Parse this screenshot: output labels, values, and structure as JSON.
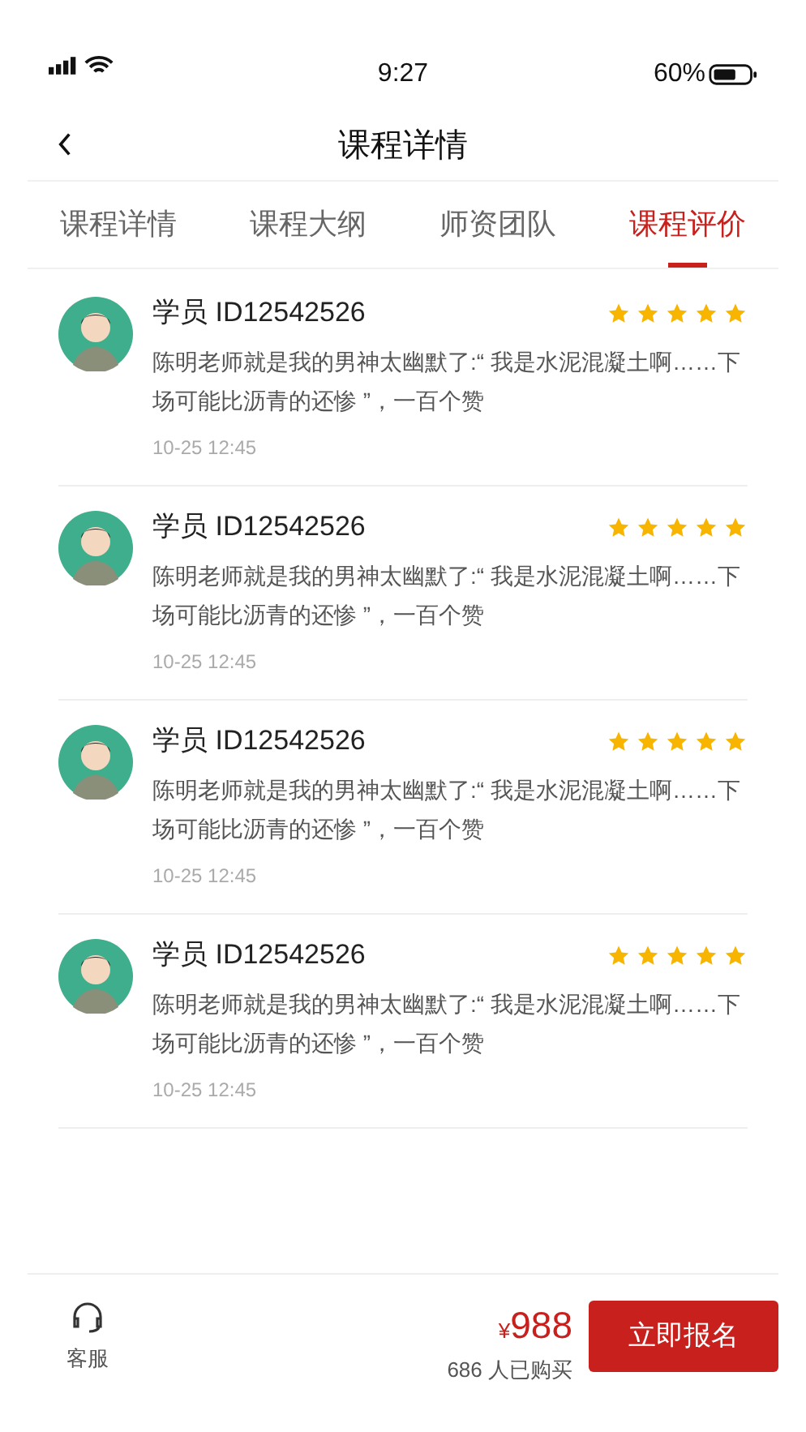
{
  "status_bar": {
    "time": "9:27",
    "battery": "60%"
  },
  "nav": {
    "title": "课程详情"
  },
  "tabs": [
    {
      "label": "课程详情",
      "selected": false
    },
    {
      "label": "课程大纲",
      "selected": false
    },
    {
      "label": "师资团队",
      "selected": false
    },
    {
      "label": "课程评价",
      "selected": true
    }
  ],
  "reviews": [
    {
      "user": "学员 ID12542526",
      "stars": 5,
      "comment": "陈明老师就是我的男神太幽默了:“ 我是水泥混凝土啊……下场可能比沥青的还惨 ”，一百个赞",
      "time": "10-25  12:45"
    },
    {
      "user": "学员 ID12542526",
      "stars": 5,
      "comment": "陈明老师就是我的男神太幽默了:“ 我是水泥混凝土啊……下场可能比沥青的还惨 ”，一百个赞",
      "time": "10-25  12:45"
    },
    {
      "user": "学员 ID12542526",
      "stars": 5,
      "comment": "陈明老师就是我的男神太幽默了:“ 我是水泥混凝土啊……下场可能比沥青的还惨 ”，一百个赞",
      "time": "10-25  12:45"
    },
    {
      "user": "学员 ID12542526",
      "stars": 5,
      "comment": "陈明老师就是我的男神太幽默了:“ 我是水泥混凝土啊……下场可能比沥青的还惨 ”，一百个赞",
      "time": "10-25  12:45"
    }
  ],
  "bottom_bar": {
    "service_label": "客服",
    "currency": "¥",
    "price": "988",
    "buyers": "686 人已购买",
    "enroll_button": "立即报名"
  }
}
